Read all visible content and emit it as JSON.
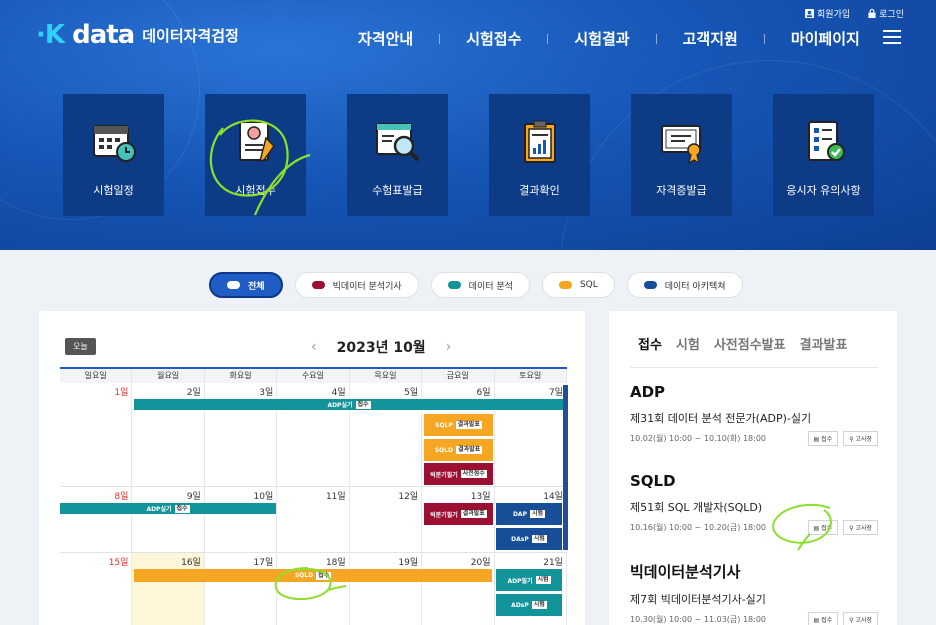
{
  "header": {
    "logo_main": "data",
    "logo_sub": "데이터자격검정",
    "top_links": [
      {
        "label": "회원가입",
        "icon": "person-icon"
      },
      {
        "label": "로그인",
        "icon": "lock-icon"
      }
    ],
    "nav": [
      "자격안내",
      "시험접수",
      "시험결과",
      "고객지원",
      "마이페이지"
    ]
  },
  "tiles": [
    {
      "label": "시험일정",
      "icon": "calendar-clock-icon"
    },
    {
      "label": "시험접수",
      "icon": "application-form-icon"
    },
    {
      "label": "수험표발급",
      "icon": "ticket-search-icon"
    },
    {
      "label": "결과확인",
      "icon": "clipboard-chart-icon"
    },
    {
      "label": "자격증발급",
      "icon": "certificate-icon"
    },
    {
      "label": "응시자 유의사항",
      "icon": "checklist-icon"
    }
  ],
  "filters": [
    {
      "label": "전체",
      "color": "#ffffff",
      "active": true
    },
    {
      "label": "빅데이터 분석기사",
      "color": "#9b1030"
    },
    {
      "label": "데이터 분석",
      "color": "#12949a"
    },
    {
      "label": "SQL",
      "color": "#f5a623"
    },
    {
      "label": "데이터 아키텍쳐",
      "color": "#164f98"
    }
  ],
  "calendar": {
    "today_label": "오늘",
    "title": "2023년 10월",
    "prev": "‹",
    "next": "›",
    "weekdays": [
      "일요일",
      "월요일",
      "화요일",
      "수요일",
      "목요일",
      "금요일",
      "토요일"
    ],
    "weeks": [
      [
        "1일",
        "2일",
        "3일",
        "4일",
        "5일",
        "6일",
        "7일"
      ],
      [
        "8일",
        "9일",
        "10일",
        "11일",
        "12일",
        "13일",
        "14일"
      ],
      [
        "15일",
        "16일",
        "17일",
        "18일",
        "19일",
        "20일",
        "21일"
      ]
    ],
    "events": {
      "adp_w1": {
        "label": "ADP실기",
        "tag": "접수"
      },
      "sqlp": {
        "label": "SQLP",
        "tag": "결과발표"
      },
      "sqld": {
        "label": "SQLD",
        "tag": "결과발표"
      },
      "bigdata_w1": {
        "label": "빅분기필기",
        "tag": "사전점수"
      },
      "adp_w2": {
        "label": "ADP실기",
        "tag": "접수"
      },
      "bigdata_w2": {
        "label": "빅분기필기",
        "tag": "결과발표"
      },
      "dap": {
        "label": "DAP",
        "tag": "시험"
      },
      "dasp": {
        "label": "DAsP",
        "tag": "시험"
      },
      "sqld_w3": {
        "label": "SQLD",
        "tag": "접수"
      },
      "adp_w3": {
        "label": "ADP필기",
        "tag": "시험"
      },
      "adsp": {
        "label": "ADsP",
        "tag": "시험"
      }
    }
  },
  "colors": {
    "adp": "#12949a",
    "sql": "#f5a623",
    "bigdata": "#9b1030",
    "dap": "#164f98"
  },
  "side": {
    "tabs": [
      "접수",
      "시험",
      "사전점수발표",
      "결과발표"
    ],
    "items": [
      {
        "cat": "ADP",
        "name": "제31회 데이터 분석 전문가(ADP)-실기",
        "date": "10.02(월) 10:00 ~ 10.10(화) 18:00",
        "btn1": "접수",
        "btn2": "고사장"
      },
      {
        "cat": "SQLD",
        "name": "제51회 SQL 개발자(SQLD)",
        "date": "10.16(월) 10:00 ~ 10.20(금) 18:00",
        "btn1": "접수",
        "btn2": "고사장"
      },
      {
        "cat": "빅데이터분석기사",
        "name": "제7회 빅데이터분석기사-실기",
        "date": "10.30(월) 10:00 ~ 11.03(금) 18:00",
        "btn1": "접수",
        "btn2": "고사장"
      }
    ]
  }
}
